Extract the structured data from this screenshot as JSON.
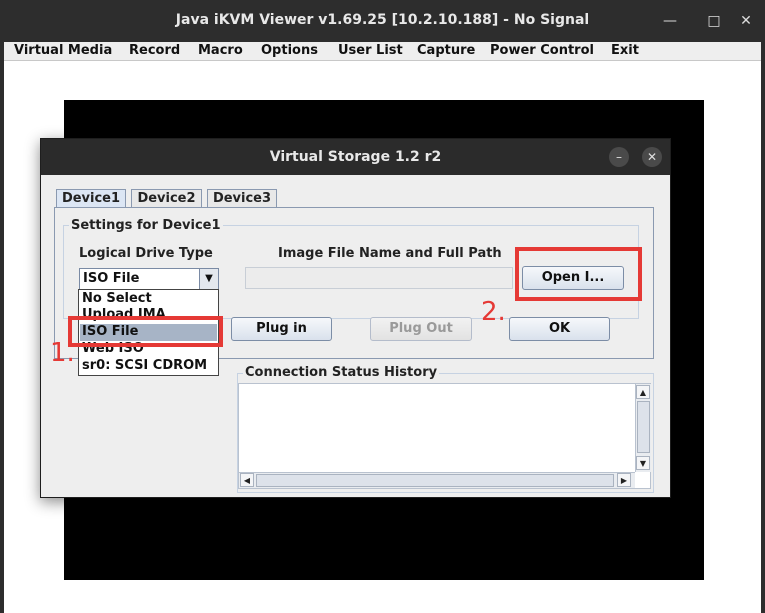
{
  "window": {
    "title": "Java iKVM Viewer v1.69.25 [10.2.10.188]  - No Signal",
    "controls": [
      "minimize-icon",
      "maximize-icon",
      "close-icon"
    ]
  },
  "menu": [
    "Virtual Media",
    "Record",
    "Macro",
    "Options",
    "User List",
    "Capture",
    "Power Control",
    "Exit"
  ],
  "dialog": {
    "title": "Virtual Storage 1.2 r2",
    "tabs": [
      "Device1",
      "Device2",
      "Device3"
    ],
    "active_tab": "Device1",
    "group_title": "Settings for Device1",
    "logical_drive_label": "Logical Drive Type",
    "logical_drive_value": "ISO File",
    "image_path_label": "Image File Name and Full Path",
    "image_path_value": "",
    "open_button": "Open I...",
    "plug_in_button": "Plug in",
    "plug_out_button": "Plug Out",
    "ok_button": "OK",
    "status_label": "Connection Status History"
  },
  "dropdown": {
    "options": [
      "No Select",
      "Upload IMA",
      "ISO File",
      "Web ISO",
      "sr0: SCSI CDROM"
    ],
    "selected": "ISO File"
  },
  "annotations": {
    "step1": "1.",
    "step2": "2.",
    "color": "#e53935"
  },
  "colors": {
    "titlebar": "#2d2d2d",
    "selection": "#a7b4c6",
    "tab_active": "#dce6f4"
  }
}
